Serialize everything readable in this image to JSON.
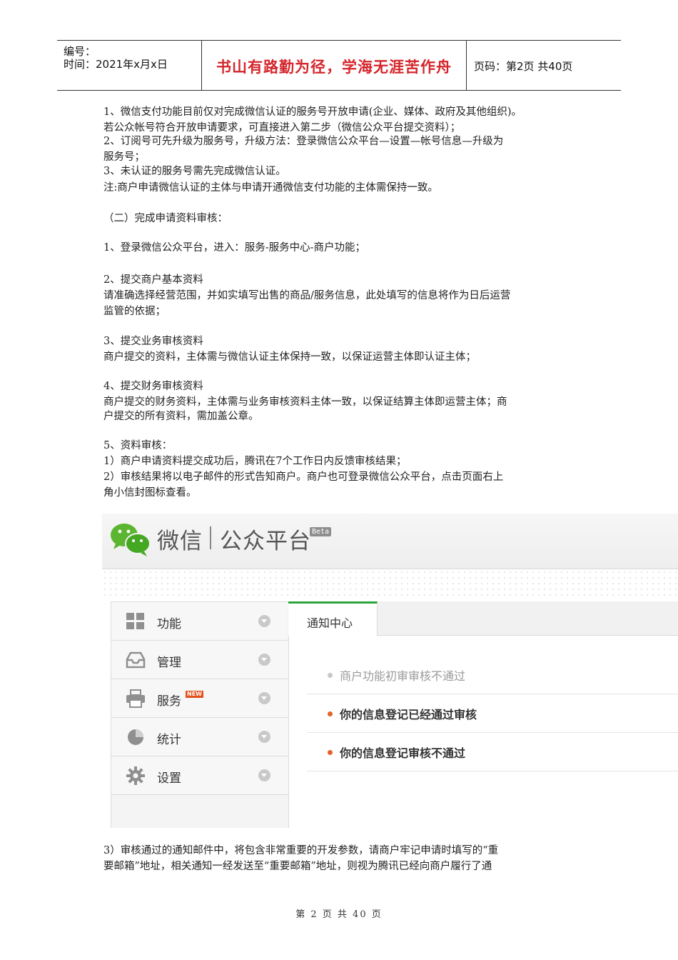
{
  "header": {
    "number_label": "编号：",
    "date_line": "时间：2021年x月x日",
    "motto": "书山有路勤为径，学海无涯苦作舟",
    "page_info": "页码：第2页  共40页"
  },
  "body": {
    "paragraphs": [
      "1、微信支付功能目前仅对完成微信认证的服务号开放申请(企业、媒体、政府及其他组织)。",
      "若公众帐号符合开放申请要求，可直接进入第二步（微信公众平台提交资料）；",
      "2、订阅号可先升级为服务号，升级方法：登录微信公众平台—设置—帐号信息—升级为",
      "服务号；",
      "3、未认证的服务号需先完成微信认证。",
      "注:商户申请微信认证的主体与申请开通微信支付功能的主体需保持一致。",
      "（二）完成申请资料审核：",
      "1、登录微信公众平台，进入：服务-服务中心-商户功能；",
      "2、提交商户基本资料",
      "请准确选择经营范围，并如实填写出售的商品/服务信息，此处填写的信息将作为日后运营",
      "监管的依据；",
      "3、提交业务审核资料",
      "商户提交的资料，主体需与微信认证主体保持一致，以保证运营主体即认证主体；",
      "4、提交财务审核资料",
      "商户提交的财务资料，主体需与业务审核资料主体一致，以保证结算主体即运营主体；商",
      "户提交的所有资料，需加盖公章。",
      "5、资料审核：",
      "1）商户申请资料提交成功后，腾讯在7个工作日内反馈审核结果；",
      "2）审核结果将以电子邮件的形式告知商户。商户也可登录微信公众平台，点击页面右上",
      "角小信封图标查看。",
      "3）审核通过的通知邮件中，将包含非常重要的开发参数，请商户牢记申请时填写的“重",
      "要邮箱”地址，相关通知一经发送至“重要邮箱”地址，则视为腾讯已经向商户履行了通"
    ]
  },
  "screenshot": {
    "brand_left": "微信",
    "brand_right": "公众平台",
    "beta": "Beta",
    "menu": [
      {
        "label": "功能",
        "icon": "grid-icon"
      },
      {
        "label": "管理",
        "icon": "inbox-icon"
      },
      {
        "label": "服务",
        "icon": "printer-icon",
        "badge": "NEW"
      },
      {
        "label": "统计",
        "icon": "pie-chart-icon"
      },
      {
        "label": "设置",
        "icon": "gear-icon"
      }
    ],
    "tab": "通知中心",
    "notifications": [
      {
        "text": "商户功能初审审核不通过",
        "color": "#9a9a9a",
        "dot": "#c8c8c8",
        "bold": false
      },
      {
        "text": "你的信息登记已经通过审核",
        "color": "#333333",
        "dot": "#e4622c",
        "bold": true
      },
      {
        "text": "你的信息登记审核不通过",
        "color": "#333333",
        "dot": "#e4622c",
        "bold": true
      }
    ]
  },
  "footer": {
    "page_text": "第 2 页 共 40 页"
  }
}
